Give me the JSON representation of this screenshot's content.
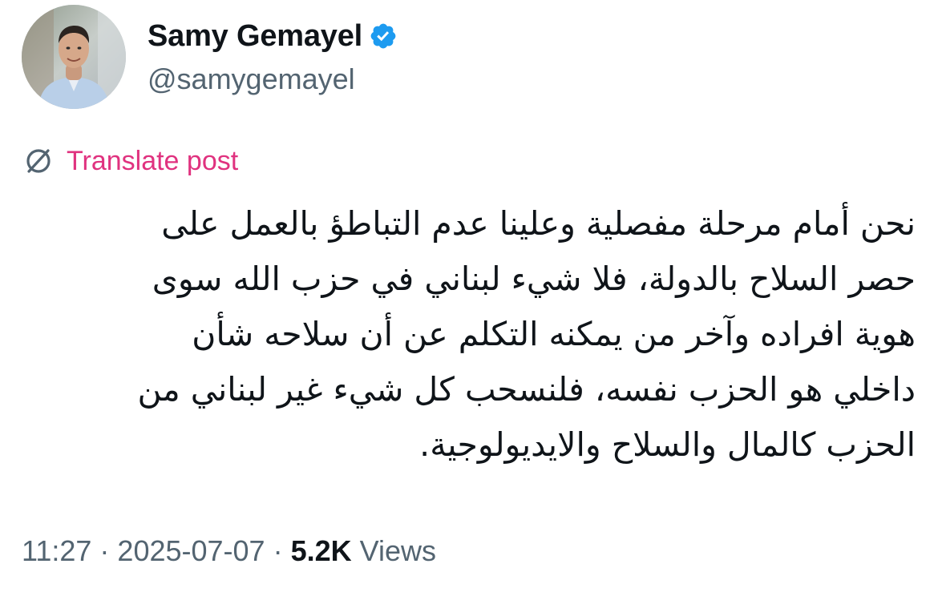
{
  "author": {
    "name": "Samy Gemayel",
    "handle": "@samygemayel",
    "verified": true,
    "verified_badge_color": "#1d9bf0",
    "avatar_icon": "profile-photo"
  },
  "translate": {
    "icon": "translate-globe-icon",
    "label": "Translate post",
    "color": "#e0327f"
  },
  "post": {
    "lines": [
      "نحن أمام مرحلة مفصلية وعلينا عدم التباطؤ بالعمل على",
      "حصر السلاح بالدولة، فلا شيء لبناني في حزب الله سوى",
      "هوية افراده وآخر من يمكنه التكلم عن أن سلاحه شأن",
      "داخلي هو الحزب نفسه، فلنسحب كل شيء غير لبناني من",
      "الحزب كالمال والسلاح والايديولوجية."
    ]
  },
  "meta": {
    "time": "11:27",
    "separator": "·",
    "date": "2025-07-07",
    "views_count": "5.2K",
    "views_label": "Views",
    "muted_color": "#536471"
  }
}
